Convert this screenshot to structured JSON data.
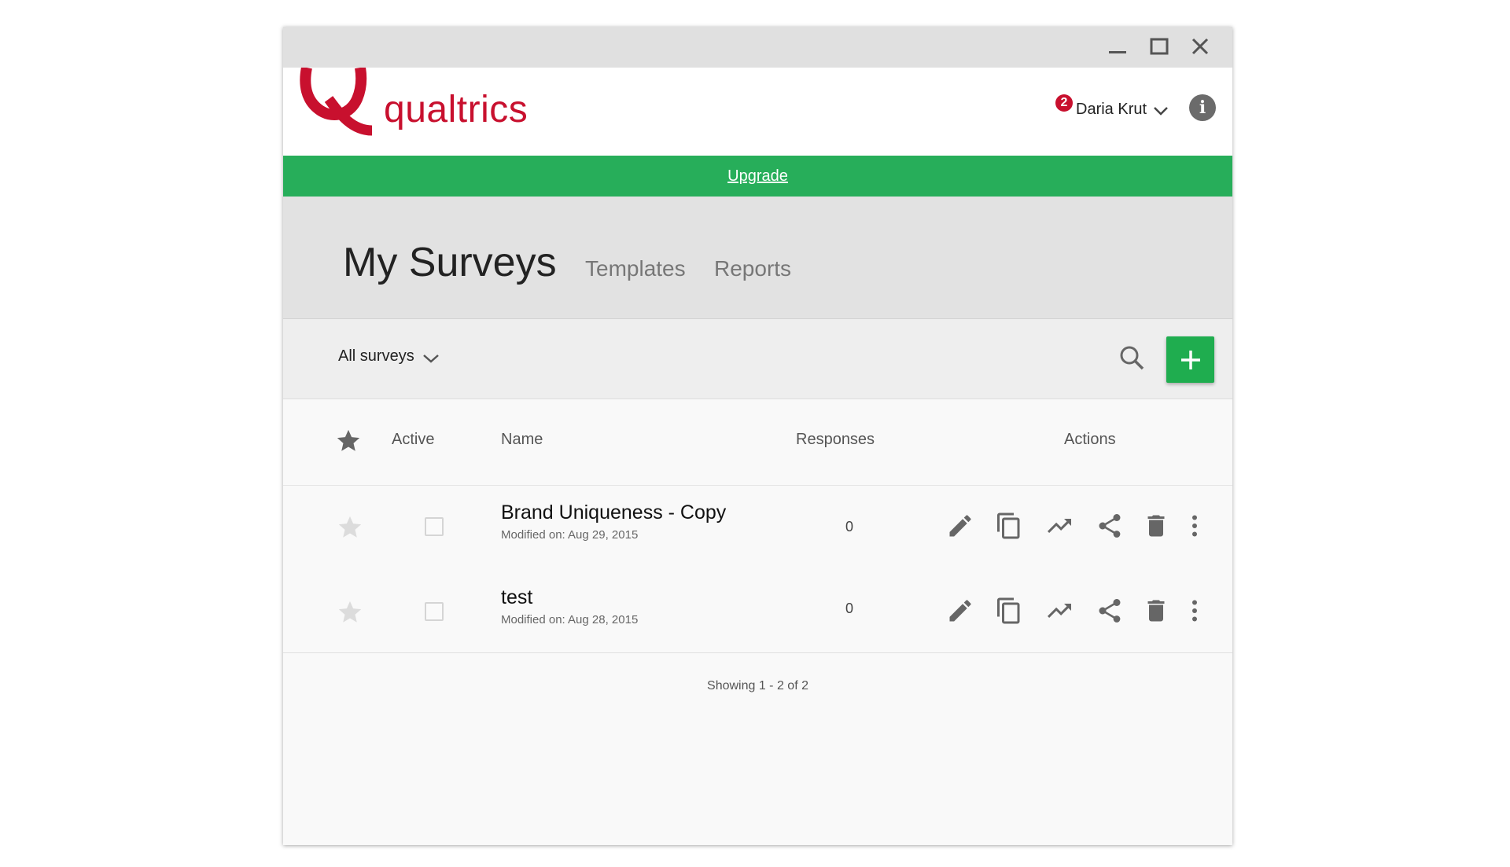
{
  "window": {
    "controls": {
      "minimize": "minimize-icon",
      "maximize": "maximize-icon",
      "close": "close-icon"
    }
  },
  "header": {
    "logo_text": "qualtrics",
    "brand_color": "#c8102e",
    "notification_count": "2",
    "user_name": "Daria Krut",
    "info_icon": "info-icon"
  },
  "upgrade": {
    "label": "Upgrade",
    "color": "#27ae5a"
  },
  "tabs": {
    "active": "My Surveys",
    "others": [
      "Templates",
      "Reports"
    ]
  },
  "toolbar": {
    "filter_label": "All surveys",
    "search_icon": "search-icon",
    "add_icon": "plus-icon",
    "add_color": "#1fad4f"
  },
  "table": {
    "columns": {
      "favorite": "star-icon",
      "active": "Active",
      "name": "Name",
      "responses": "Responses",
      "actions": "Actions"
    },
    "rows": [
      {
        "name": "Brand Uniqueness - Copy",
        "modified": "Modified on: Aug 29, 2015",
        "responses": "0",
        "favorite": false,
        "active": false
      },
      {
        "name": "test",
        "modified": "Modified on: Aug 28, 2015",
        "responses": "0",
        "favorite": false,
        "active": false
      }
    ],
    "action_icons": [
      "edit-icon",
      "copy-icon",
      "trending-up-icon",
      "share-icon",
      "delete-icon",
      "more-vert-icon"
    ]
  },
  "pagination": {
    "text": "Showing 1 - 2 of 2"
  }
}
